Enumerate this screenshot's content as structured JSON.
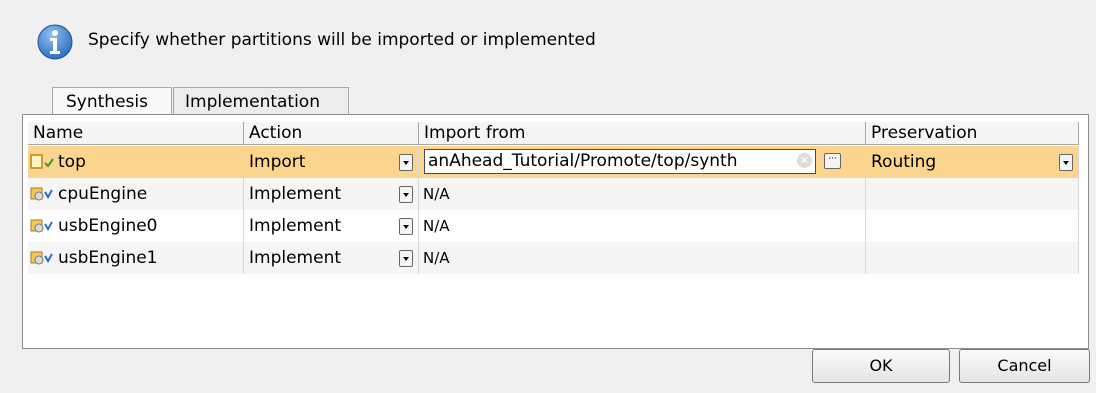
{
  "dialog": {
    "message": "Specify whether partitions will be imported or implemented"
  },
  "tabs": [
    {
      "label": "Synthesis",
      "active": true
    },
    {
      "label": "Implementation",
      "active": false
    }
  ],
  "table": {
    "columns": [
      "Name",
      "Action",
      "Import from",
      "Preservation"
    ],
    "rows": [
      {
        "name": "top",
        "action": "Import",
        "import_from": "anAhead_Tutorial/Promote/top/synth",
        "preservation": "Routing",
        "selected": true
      },
      {
        "name": "cpuEngine",
        "action": "Implement",
        "import_from": "N/A",
        "preservation": ""
      },
      {
        "name": "usbEngine0",
        "action": "Implement",
        "import_from": "N/A",
        "preservation": ""
      },
      {
        "name": "usbEngine1",
        "action": "Implement",
        "import_from": "N/A",
        "preservation": ""
      }
    ]
  },
  "buttons": {
    "ok": "OK",
    "cancel": "Cancel"
  },
  "colors": {
    "selection": "#fbd48d",
    "info_icon": "#2f6fbd",
    "check_green": "#2e9e2e",
    "check_blue": "#1f6fd1"
  }
}
